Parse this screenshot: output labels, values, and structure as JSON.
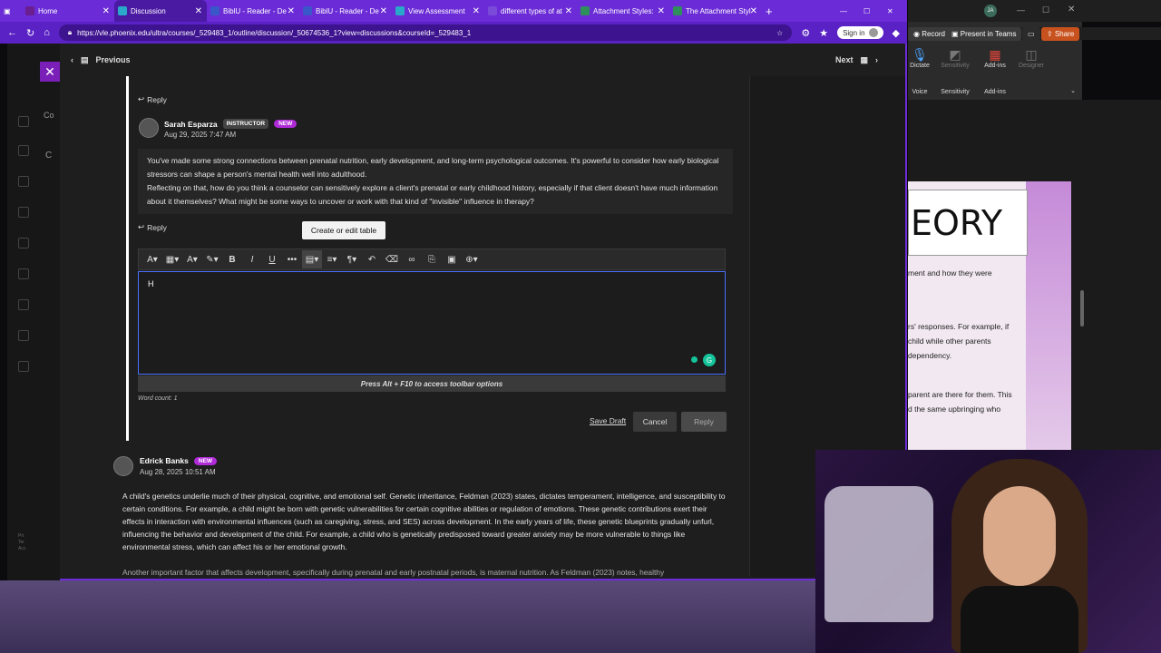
{
  "browser": {
    "tabs": [
      {
        "label": "Home"
      },
      {
        "label": "Discussion"
      },
      {
        "label": "BiblU - Reader - De"
      },
      {
        "label": "BiblU - Reader - De"
      },
      {
        "label": "View Assessment"
      },
      {
        "label": "different types of at"
      },
      {
        "label": "Attachment Styles:"
      },
      {
        "label": "The Attachment Styl"
      }
    ],
    "url": "https://vle.phoenix.edu/ultra/courses/_529483_1/outline/discussion/_50674536_1?view=discussions&courseId=_529483_1",
    "signin_label": "Sign in"
  },
  "nav": {
    "previous_label": "Previous",
    "next_label": "Next"
  },
  "left_strip": {
    "label1": "Co",
    "label2": "C",
    "footer": "Pri Ter Acc"
  },
  "thread": {
    "reply_label": "Reply",
    "post1": {
      "author": "Sarah Esparza",
      "role_badge": "INSTRUCTOR",
      "new_badge": "NEW",
      "date": "Aug 29, 2025 7:47 AM",
      "para1": "You've made some strong connections between prenatal nutrition, early development, and long-term psychological outcomes. It's powerful to consider how early biological stressors can shape a person's mental health well into adulthood.",
      "para2": "Reflecting on that, how do you think a counselor can sensitively explore a client's prenatal or early childhood history, especially if that client doesn't have much information about it themselves? What might be some ways to uncover or work with that kind of \"invisible\" influence in therapy?"
    },
    "editor": {
      "tooltip": "Create or edit table",
      "content": "H",
      "access_hint": "Press Alt + F10 to access toolbar options",
      "word_count": "Word count: 1",
      "save_draft": "Save Draft",
      "cancel": "Cancel",
      "reply": "Reply"
    },
    "post2": {
      "author": "Edrick Banks",
      "new_badge": "NEW",
      "date": "Aug 28, 2025 10:51 AM",
      "para1": "A child's genetics underlie much of their physical, cognitive, and emotional self. Genetic inheritance, Feldman (2023) states, dictates temperament, intelligence, and susceptibility to certain conditions. For example, a child might be born with genetic vulnerabilities for certain cognitive abilities or regulation of emotions. These genetic contributions exert their effects in interaction with environmental influences (such as caregiving, stress, and SES) across development. In the early years of life, these genetic blueprints gradually unfurl, influencing the behavior and development of the child. For example, a child who is genetically predisposed toward greater anxiety may be more vulnerable to things like environmental stress, which can affect his or her emotional growth.",
      "para2": "Another important factor that affects development, specifically during prenatal and early postnatal periods, is maternal nutrition. As Feldman (2023) notes, healthy"
    }
  },
  "word_app": {
    "record": "Record",
    "present": "Present in Teams",
    "share": "Share",
    "dictate": "Dictate",
    "sensitivity": "Sensitivity",
    "addins": "Add-ins",
    "designer": "Designer",
    "group_voice": "Voice",
    "group_sensitivity": "Sensitivity",
    "group_addins": "Add-ins",
    "heading": "EORY",
    "line1": "ment and how they were",
    "line2": "rs' responses. For example, if",
    "line3": "child while other parents",
    "line4": "dependency.",
    "line5": "parent are there for them. This",
    "line6": "d the same upbringing who"
  }
}
